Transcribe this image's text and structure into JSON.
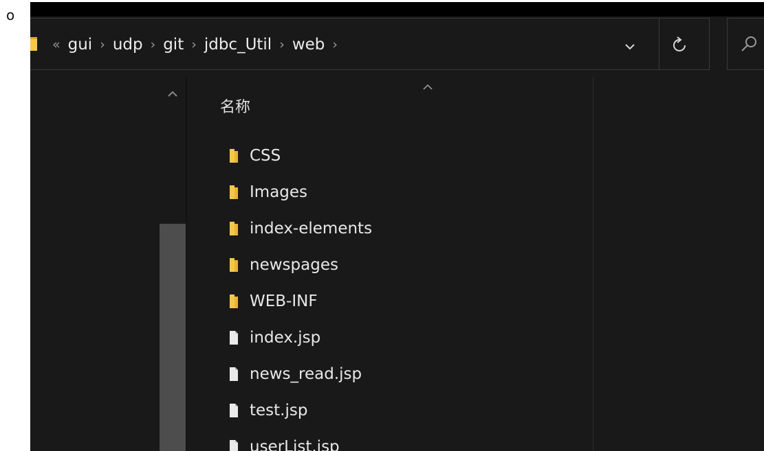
{
  "page": {
    "bullet": "o"
  },
  "colors": {
    "window_bg": "#191919",
    "top_strip": "#000000",
    "folder_yellow": "#f7c846",
    "file_white": "#eaeaea",
    "text": "#e8e8e8",
    "separator": "#9a9a9a"
  },
  "address_bar": {
    "overflow": "«",
    "separator": "›",
    "crumbs": [
      "gui",
      "udp",
      "git",
      "jdbc_Util",
      "web"
    ],
    "icons": {
      "location": "folder-icon",
      "history": "chevron-down-icon",
      "refresh": "refresh-icon",
      "search": "search-icon"
    }
  },
  "file_list": {
    "column_name": "名称",
    "items": [
      {
        "name": "CSS",
        "type": "folder"
      },
      {
        "name": "Images",
        "type": "folder"
      },
      {
        "name": "index-elements",
        "type": "folder"
      },
      {
        "name": "newspages",
        "type": "folder"
      },
      {
        "name": "WEB-INF",
        "type": "folder"
      },
      {
        "name": "index.jsp",
        "type": "file"
      },
      {
        "name": "news_read.jsp",
        "type": "file"
      },
      {
        "name": "test.jsp",
        "type": "file"
      },
      {
        "name": "userList.jsp",
        "type": "file"
      }
    ]
  }
}
